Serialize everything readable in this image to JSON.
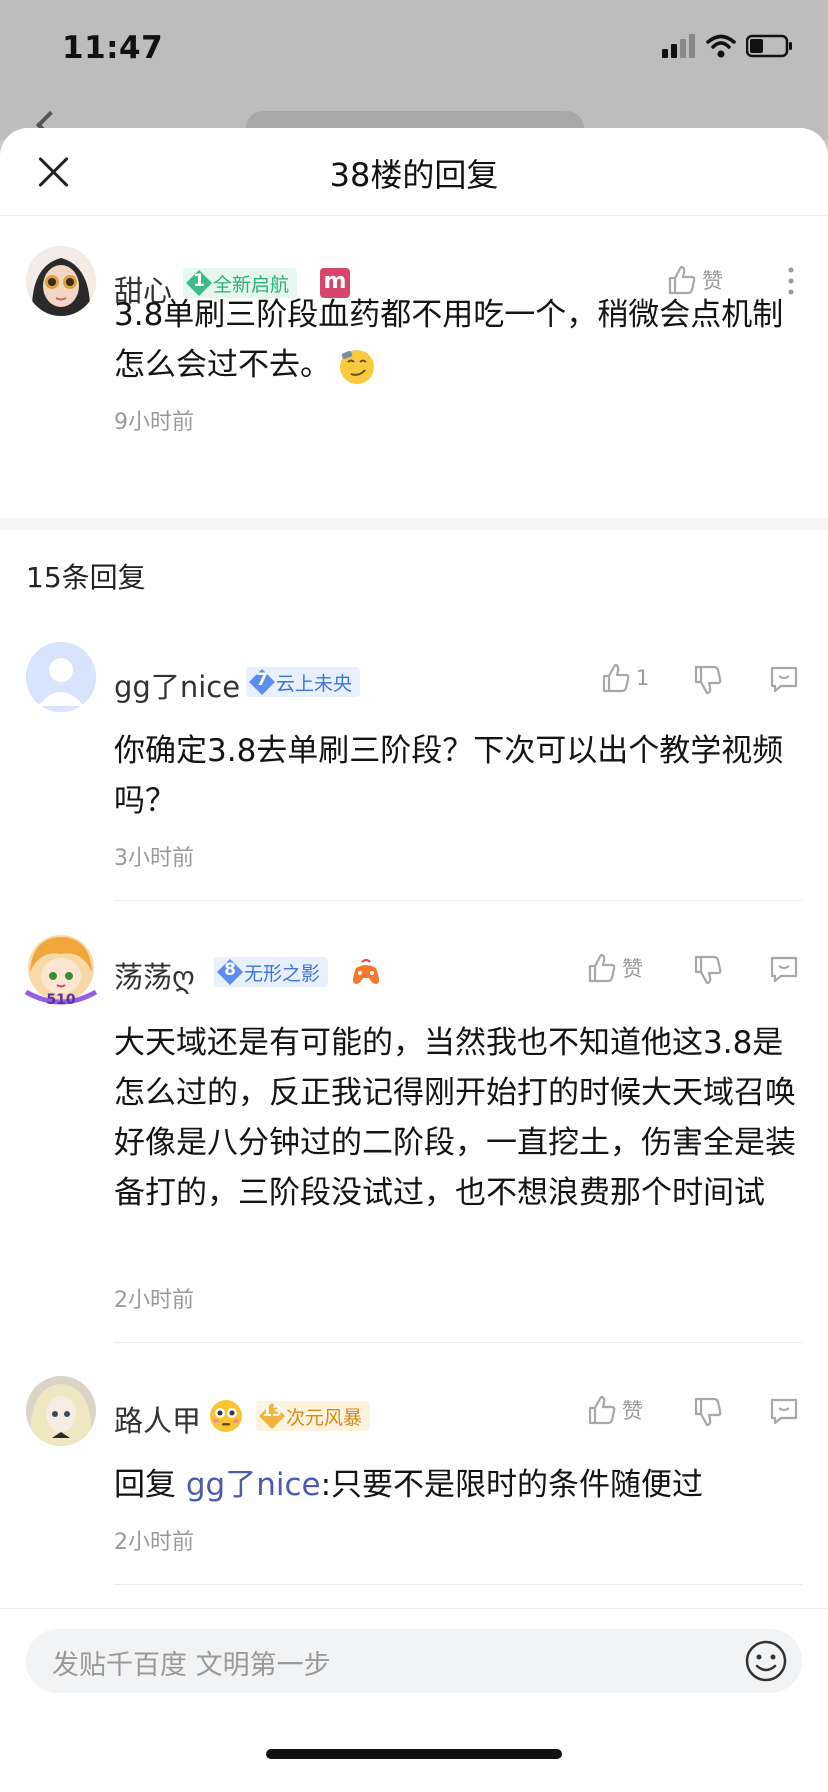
{
  "status": {
    "time": "11:47"
  },
  "sheet": {
    "title": "38楼的回复"
  },
  "main_post": {
    "user": "甜心",
    "badge_level": "1",
    "badge_text": "全新启航",
    "extra_badge": "m",
    "like_label": "赞",
    "text": "3.8单刷三阶段血药都不用吃一个，稍微会点机制怎么会过不去。",
    "time": "9小时前"
  },
  "reply_count": "15条回复",
  "replies": [
    {
      "user": "gg了nice",
      "badge_level": "7",
      "badge_text": "云上未央",
      "like_label": "1",
      "text": "你确定3.8去单刷三阶段？下次可以出个教学视频吗？",
      "time": "3小时前"
    },
    {
      "user": "荡荡ღ",
      "badge_level": "8",
      "badge_text": "无形之影",
      "avatar_tag": "510",
      "like_label": "赞",
      "text": "大天域还是有可能的，当然我也不知道他这3.8是怎么过的，反正我记得刚开始打的时候大天域召唤好像是八分钟过的二阶段，一直挖土，伤害全是装备打的，三阶段没试过，也不想浪费那个时间试",
      "time": "2小时前"
    },
    {
      "user": "路人甲",
      "badge_level": "13",
      "badge_text": "次元风暴",
      "like_label": "赞",
      "reply_prefix": "回复 ",
      "reply_target": "gg了nice",
      "text": ":只要不是限时的条件随便过",
      "time": "2小时前"
    }
  ],
  "bottom": {
    "placeholder": "发贴千百度 文明第一步"
  },
  "colors": {
    "accent_link": "#4a5ab5",
    "green_badge": "#3dbb8a",
    "blue_badge": "#5b8ef0",
    "orange_badge": "#f1b43a"
  }
}
